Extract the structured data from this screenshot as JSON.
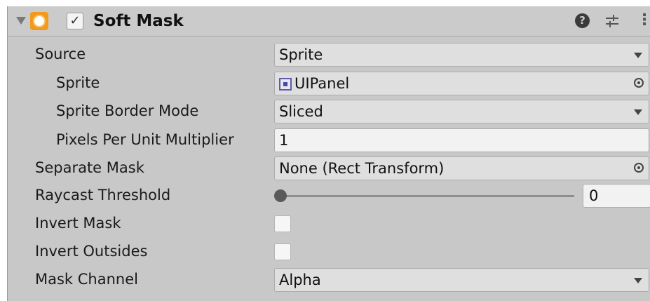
{
  "component": {
    "title": "Soft Mask",
    "enabled_check": "✓",
    "help_glyph": "?"
  },
  "properties": {
    "source": {
      "label": "Source",
      "value": "Sprite"
    },
    "sprite": {
      "label": "Sprite",
      "value": "UIPanel"
    },
    "sprite_border_mode": {
      "label": "Sprite Border Mode",
      "value": "Sliced"
    },
    "pixels_per_unit_multiplier": {
      "label": "Pixels Per Unit Multiplier",
      "value": "1"
    },
    "separate_mask": {
      "label": "Separate Mask",
      "value": "None (Rect Transform)"
    },
    "raycast_threshold": {
      "label": "Raycast Threshold",
      "value": "0",
      "fraction": 0
    },
    "invert_mask": {
      "label": "Invert Mask",
      "checked": false
    },
    "invert_outsides": {
      "label": "Invert Outsides",
      "checked": false
    },
    "mask_channel": {
      "label": "Mask Channel",
      "value": "Alpha"
    }
  }
}
